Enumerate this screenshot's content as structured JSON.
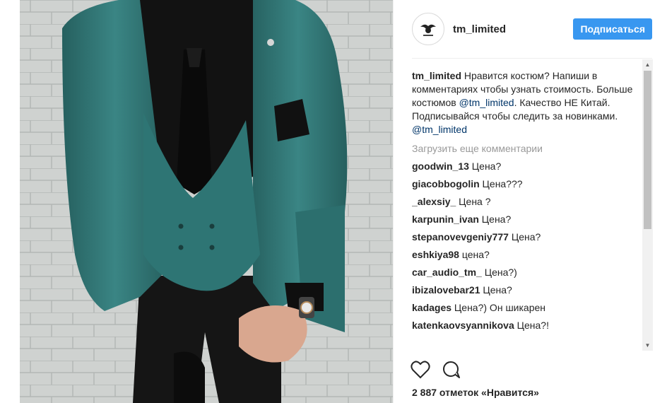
{
  "post": {
    "username": "tm_limited",
    "follow_label": "Подписаться",
    "caption": {
      "author": "tm_limited",
      "text_1": " Нравится костюм? Напиши в комментариях чтобы узнать стоимость. Больше костюмов ",
      "mention_1": "@tm_limited",
      "text_2": ". Качество НЕ Китай. Подписывайся чтобы следить за новинками. ",
      "mention_2": "@tm_limited"
    },
    "load_more_label": "Загрузить еще комментарии",
    "comments": [
      {
        "author": "goodwin_13",
        "text": " Цена?"
      },
      {
        "author": "giacobbogolin",
        "text": " Цена???"
      },
      {
        "author": "_alexsiy_",
        "text": " Цена ?"
      },
      {
        "author": "karpunin_ivan",
        "text": " Цена?"
      },
      {
        "author": "stepanovevgeniy777",
        "text": " Цена?"
      },
      {
        "author": "eshkiya98",
        "text": " цена?"
      },
      {
        "author": "car_audio_tm_",
        "text": " Цена?)"
      },
      {
        "author": "ibizalovebar21",
        "text": " Цена?"
      },
      {
        "author": "kadages",
        "text": " Цена?) Он шикарен"
      },
      {
        "author": "katenkaovsyannikova",
        "text": " Цена?!"
      }
    ],
    "likes_text": "2 887 отметок «Нравится»",
    "icons": {
      "avatar": "tm-limited-logo",
      "like": "heart-icon",
      "comment": "comment-icon",
      "scroll_up": "arrow-up-icon",
      "scroll_down": "arrow-down-icon"
    },
    "colors": {
      "follow_button": "#3897f0",
      "mention": "#003569",
      "muted": "#999999",
      "suit": "#2f7574"
    }
  }
}
